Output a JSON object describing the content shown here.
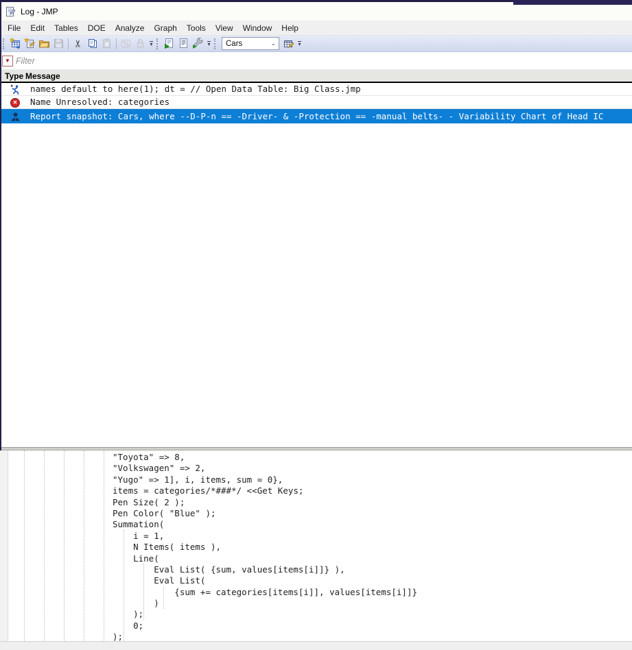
{
  "window": {
    "title": "Log - JMP"
  },
  "menu": {
    "items": [
      "File",
      "Edit",
      "Tables",
      "DOE",
      "Analyze",
      "Graph",
      "Tools",
      "View",
      "Window",
      "Help"
    ]
  },
  "toolbar": {
    "table_selector_value": "Cars",
    "glyphs": {
      "cut": "✂",
      "combo_chevron": "⌄",
      "overflow": "▾",
      "filter_dropdown": "▼"
    },
    "icon_names": [
      "new-data-table-icon",
      "new-script-icon",
      "open-folder-icon",
      "save-icon",
      "cut-icon",
      "copy-icon",
      "paste-icon",
      "layout-icon",
      "lock-icon",
      "run-script-icon",
      "open-log-icon",
      "tools-wrench-icon",
      "edit-table-icon"
    ]
  },
  "filter": {
    "placeholder": "Filter"
  },
  "log": {
    "columns": {
      "type": "Type",
      "message": "Message"
    },
    "entries": [
      {
        "icon": "running-man",
        "selected": false,
        "lines": [
          "names default to here(1);",
          "dt =",
          "// Open Data Table: Big Class.jmp"
        ]
      },
      {
        "icon": "error",
        "selected": false,
        "lines": [
          "Name Unresolved: categories"
        ]
      },
      {
        "icon": "snapshot-person",
        "selected": true,
        "lines": [
          "Report snapshot: Cars, where --D-P-n == -Driver- & -Protection == -manual belts- - Variability Chart of Head IC"
        ]
      }
    ],
    "error_glyph": "✕"
  },
  "code": {
    "lines": [
      "                   \"Toyota\" => 8,",
      "                   \"Volkswagen\" => 2,",
      "                   \"Yugo\" => 1], i, items, sum = 0},",
      "                   items = categories/*###*/ <<Get Keys;",
      "                   Pen Size( 2 );",
      "                   Pen Color( \"Blue\" );",
      "                   Summation(",
      "                       i = 1,",
      "                       N Items( items ),",
      "                       Line(",
      "                           Eval List( {sum, values[items[i]]} ),",
      "                           Eval List(",
      "                               {sum += categories[items[i]], values[items[i]]}",
      "                           )",
      "                       );",
      "                       0;",
      "                   );"
    ]
  },
  "colors": {
    "selection_blue": "#0e7fd6",
    "error_red": "#ce2929",
    "runner_blue": "#2a5fbe",
    "snapshot_navy": "#173560",
    "toolbar_bg": "#d8ddee",
    "window_edge": "#23204a"
  }
}
